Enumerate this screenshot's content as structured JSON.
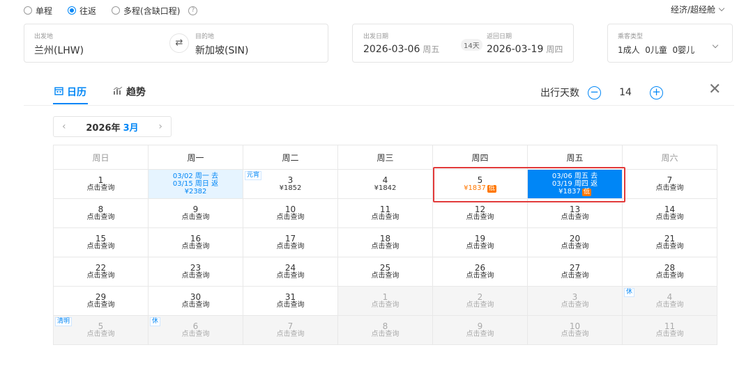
{
  "trip_type": {
    "options": [
      {
        "label": "单程",
        "selected": false
      },
      {
        "label": "往返",
        "selected": true
      },
      {
        "label": "多程(含缺口程)",
        "selected": false
      }
    ],
    "help": "?",
    "cabin": "经济/超经舱"
  },
  "search": {
    "from_label": "出发地",
    "from_value": "兰州(LHW)",
    "to_label": "目的地",
    "to_value": "新加坡(SIN)",
    "depart_label": "出发日期",
    "depart_value": "2026-03-06",
    "depart_weekday": "周五",
    "days_badge": "14天",
    "return_label": "返回日期",
    "return_value": "2026-03-19",
    "return_weekday": "周四",
    "pax_label": "乘客类型",
    "pax_value": "1成人  0儿童  0婴儿"
  },
  "tabs": {
    "calendar": "日历",
    "trend": "趋势"
  },
  "trip_days": {
    "label": "出行天数",
    "minus": "−",
    "value": "14",
    "plus": "+"
  },
  "month_nav": {
    "prev": "‹",
    "year": "2026年",
    "month": "3月",
    "next": "›"
  },
  "calendar": {
    "weekdays": [
      "周日",
      "周一",
      "周二",
      "周三",
      "周四",
      "周五",
      "周六"
    ],
    "rows": [
      [
        {
          "day": "1",
          "sub": "点击查询"
        },
        {
          "lines": [
            "03/02 周一 去",
            "03/15 周日 返",
            "¥2382"
          ],
          "style": "lightsel"
        },
        {
          "day": "3",
          "sub": "¥1852",
          "holiday": "元宵"
        },
        {
          "day": "4",
          "sub": "¥1842"
        },
        {
          "day": "5",
          "price": "¥1837",
          "low": "低",
          "style": "lowprice"
        },
        {
          "lines": [
            "03/06 周五 去",
            "03/19 周四 返",
            "¥1837"
          ],
          "low": "低",
          "style": "selected"
        },
        {
          "day": "7",
          "sub": "点击查询"
        }
      ],
      [
        {
          "day": "8",
          "sub": "点击查询"
        },
        {
          "day": "9",
          "sub": "点击查询"
        },
        {
          "day": "10",
          "sub": "点击查询"
        },
        {
          "day": "11",
          "sub": "点击查询"
        },
        {
          "day": "12",
          "sub": "点击查询"
        },
        {
          "day": "13",
          "sub": "点击查询"
        },
        {
          "day": "14",
          "sub": "点击查询"
        }
      ],
      [
        {
          "day": "15",
          "sub": "点击查询"
        },
        {
          "day": "16",
          "sub": "点击查询"
        },
        {
          "day": "17",
          "sub": "点击查询"
        },
        {
          "day": "18",
          "sub": "点击查询"
        },
        {
          "day": "19",
          "sub": "点击查询"
        },
        {
          "day": "20",
          "sub": "点击查询"
        },
        {
          "day": "21",
          "sub": "点击查询"
        }
      ],
      [
        {
          "day": "22",
          "sub": "点击查询"
        },
        {
          "day": "23",
          "sub": "点击查询"
        },
        {
          "day": "24",
          "sub": "点击查询"
        },
        {
          "day": "25",
          "sub": "点击查询"
        },
        {
          "day": "26",
          "sub": "点击查询"
        },
        {
          "day": "27",
          "sub": "点击查询"
        },
        {
          "day": "28",
          "sub": "点击查询"
        }
      ],
      [
        {
          "day": "29",
          "sub": "点击查询"
        },
        {
          "day": "30",
          "sub": "点击查询"
        },
        {
          "day": "31",
          "sub": "点击查询"
        },
        {
          "day": "1",
          "sub": "点击查询",
          "style": "grey"
        },
        {
          "day": "2",
          "sub": "点击查询",
          "style": "grey"
        },
        {
          "day": "3",
          "sub": "点击查询",
          "style": "grey"
        },
        {
          "day": "4",
          "sub": "点击查询",
          "style": "grey",
          "holiday": "休"
        }
      ],
      [
        {
          "day": "5",
          "sub": "点击查询",
          "style": "grey",
          "holiday": "清明"
        },
        {
          "day": "6",
          "sub": "点击查询",
          "style": "grey",
          "holiday": "休"
        },
        {
          "day": "7",
          "sub": "点击查询",
          "style": "grey"
        },
        {
          "day": "8",
          "sub": "点击查询",
          "style": "grey"
        },
        {
          "day": "9",
          "sub": "点击查询",
          "style": "grey"
        },
        {
          "day": "10",
          "sub": "点击查询",
          "style": "grey"
        },
        {
          "day": "11",
          "sub": "点击查询",
          "style": "grey"
        }
      ]
    ]
  },
  "colors": {
    "accent": "#0086f6",
    "low_price": "#ff7700",
    "highlight_border": "#e23a3a"
  },
  "icons": {
    "calendar_tab": "calendar-icon",
    "trend_tab": "chart-icon",
    "swap": "swap-icon",
    "close": "close-icon"
  }
}
